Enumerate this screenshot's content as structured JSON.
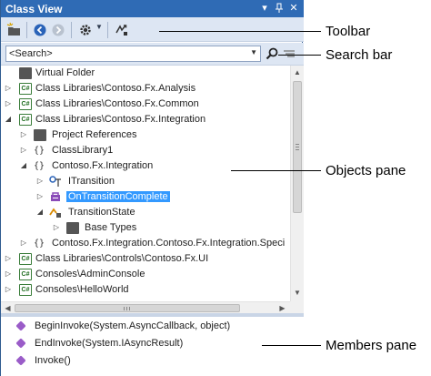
{
  "window": {
    "title": "Class View"
  },
  "toolbar": {
    "buttons": [
      "new-folder-icon",
      "back-icon",
      "forward-icon",
      "settings-icon",
      "sync-icon"
    ]
  },
  "search": {
    "value": "<Search>"
  },
  "tree": [
    {
      "label": "Virtual Folder",
      "icon": "folder-icon",
      "expander": ""
    },
    {
      "label": "Class Libraries\\Contoso.Fx.Analysis",
      "icon": "csharp-project-icon",
      "expander": "▷"
    },
    {
      "label": "Class Libraries\\Contoso.Fx.Common",
      "icon": "csharp-project-icon",
      "expander": "▷"
    },
    {
      "label": "Class Libraries\\Contoso.Fx.Integration",
      "icon": "csharp-project-icon",
      "expander": "◢"
    },
    {
      "label": "Project References",
      "icon": "folder-icon",
      "expander": "▷"
    },
    {
      "label": "ClassLibrary1",
      "icon": "namespace-icon",
      "expander": "▷"
    },
    {
      "label": "Contoso.Fx.Integration",
      "icon": "namespace-icon",
      "expander": "◢"
    },
    {
      "label": "ITransition",
      "icon": "interface-icon",
      "expander": "▷"
    },
    {
      "label": "OnTransitionComplete",
      "icon": "delegate-icon",
      "expander": "▷",
      "selected": true
    },
    {
      "label": "TransitionState",
      "icon": "enum-icon",
      "expander": "◢"
    },
    {
      "label": "Base Types",
      "icon": "folder-icon",
      "expander": "▷"
    },
    {
      "label": "Contoso.Fx.Integration.Contoso.Fx.Integration.Speci",
      "icon": "namespace-icon",
      "expander": "▷"
    },
    {
      "label": "Class Libraries\\Controls\\Contoso.Fx.UI",
      "icon": "csharp-project-icon",
      "expander": "▷"
    },
    {
      "label": "Consoles\\AdminConsole",
      "icon": "csharp-project-icon",
      "expander": "▷"
    },
    {
      "label": "Consoles\\HelloWorld",
      "icon": "csharp-project-icon",
      "expander": "▷"
    }
  ],
  "members": [
    {
      "label": "BeginInvoke(System.AsyncCallback, object)",
      "icon": "method-icon"
    },
    {
      "label": "EndInvoke(System.IAsyncResult)",
      "icon": "method-icon"
    },
    {
      "label": "Invoke()",
      "icon": "method-icon"
    }
  ],
  "callouts": {
    "toolbar": "Toolbar",
    "search_bar": "Search bar",
    "objects_pane": "Objects pane",
    "members_pane": "Members pane"
  },
  "colors": {
    "titlebar": "#2f6bb5",
    "toolbar_bg": "#dde6f3",
    "selection": "#3399ff"
  }
}
